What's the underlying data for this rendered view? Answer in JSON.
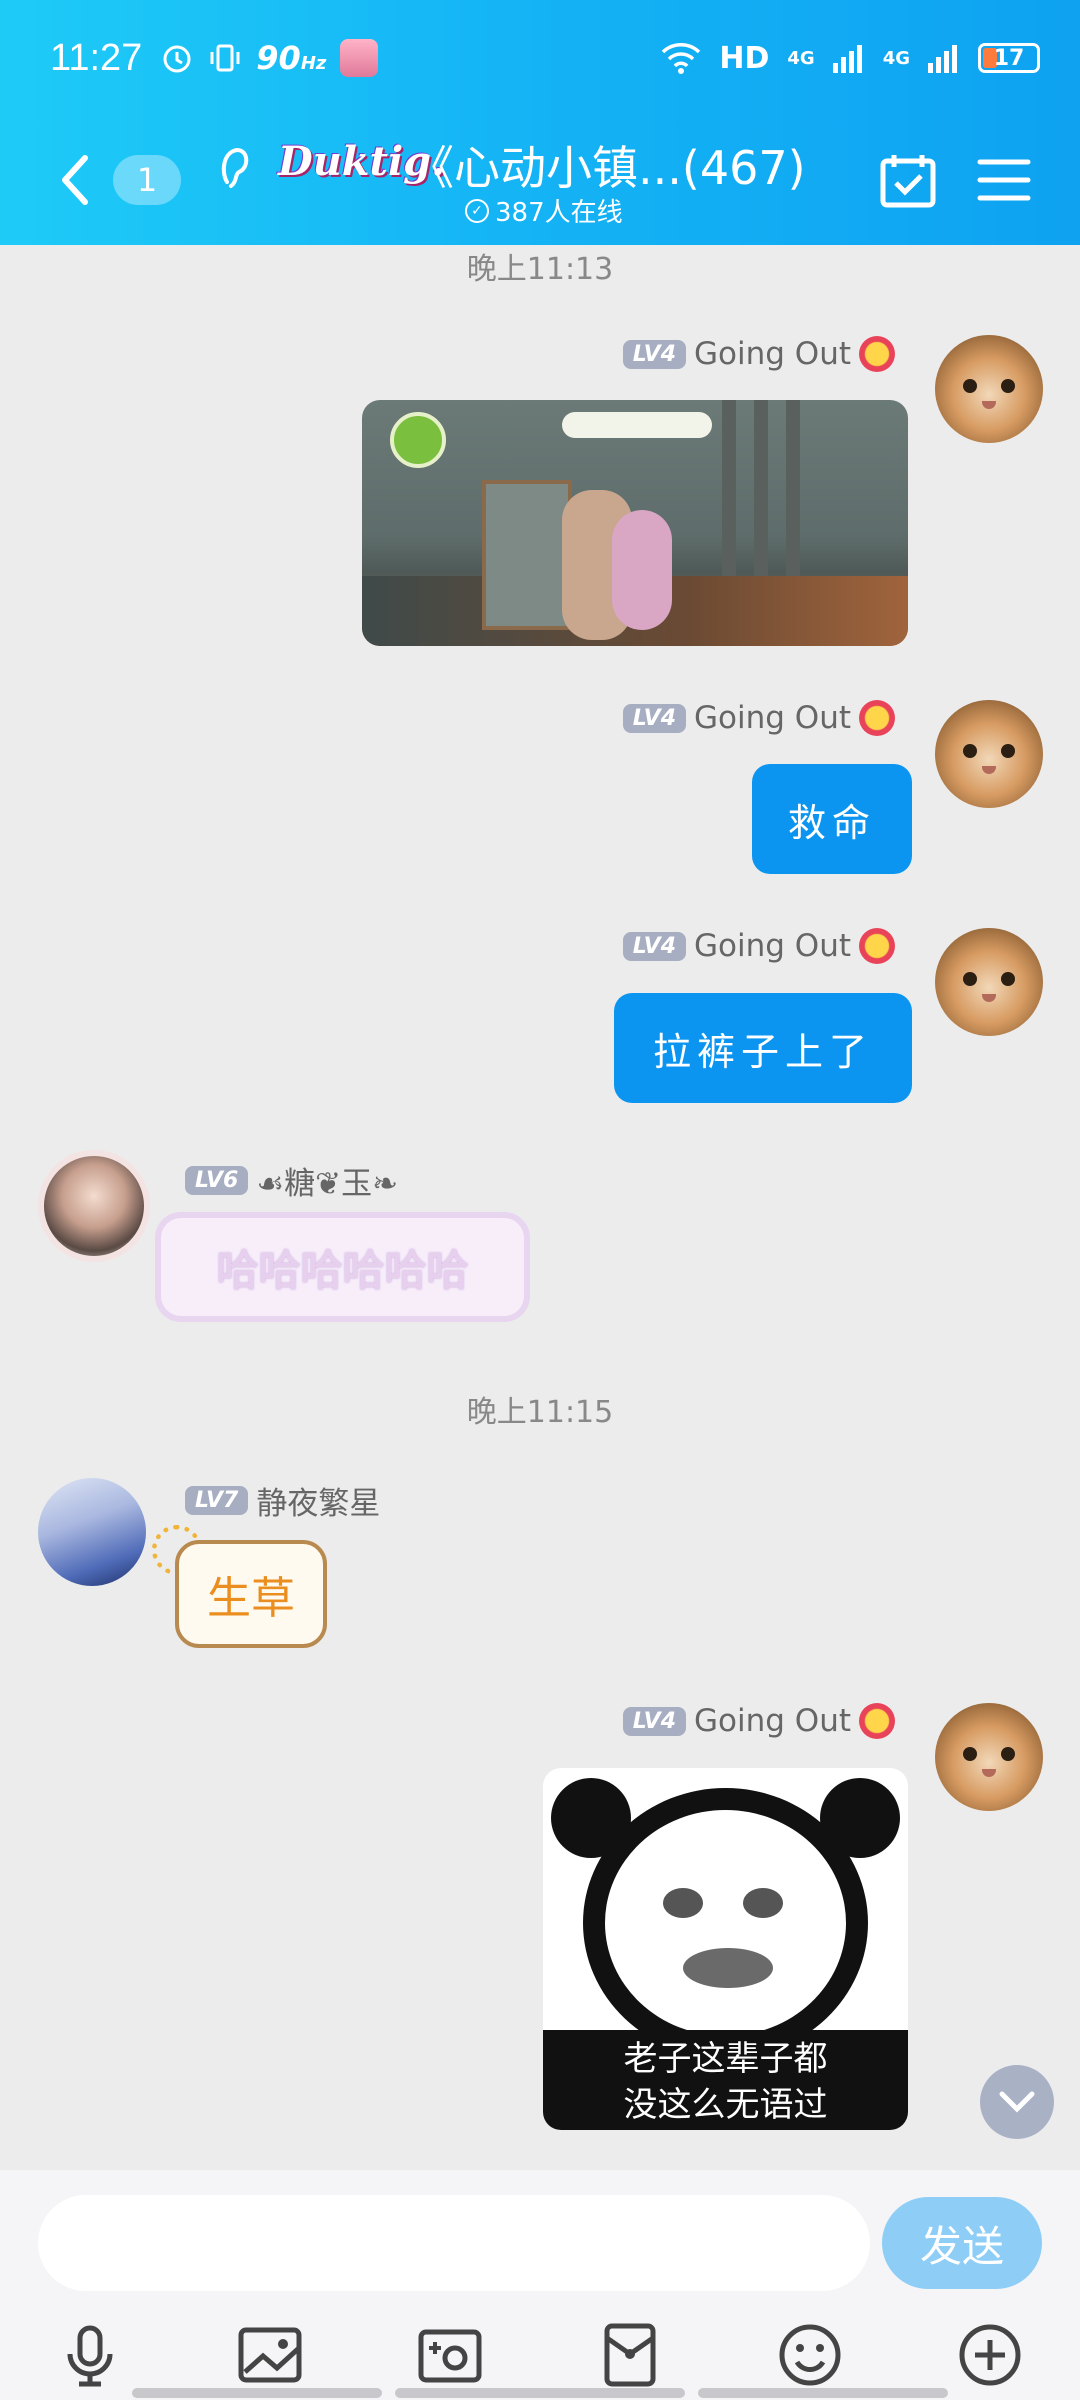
{
  "status_bar": {
    "time": "11:27",
    "refresh": "90",
    "refresh_unit": "Hz",
    "network": "HD",
    "signal1": "4G",
    "signal2": "4G",
    "battery": "17"
  },
  "header": {
    "unread_count": "1",
    "logo": "Duktig.",
    "title": "《心动小镇...(467)",
    "online": "387人在线"
  },
  "messages": {
    "ts1": "晚上11:13",
    "ts2": "晚上11:15",
    "m1": {
      "level": "LV4",
      "name": "Going Out"
    },
    "m2": {
      "level": "LV4",
      "name": "Going Out",
      "text": "救命"
    },
    "m3": {
      "level": "LV4",
      "name": "Going Out",
      "text": "拉裤子上了"
    },
    "m4": {
      "level": "LV6",
      "name": "☙糖❦玉❧",
      "text": "哈哈哈哈哈哈"
    },
    "m5": {
      "level": "LV7",
      "name": "静夜繁星",
      "text": "生草"
    },
    "m6": {
      "level": "LV4",
      "name": "Going Out",
      "caption_line1": "老子这辈子都",
      "caption_line2": "没这么无语过"
    }
  },
  "input": {
    "placeholder": "",
    "send_label": "发送"
  },
  "colors": {
    "header": "#14b3f5",
    "bubble": "#0b95f1",
    "send": "#8dcdf6"
  }
}
